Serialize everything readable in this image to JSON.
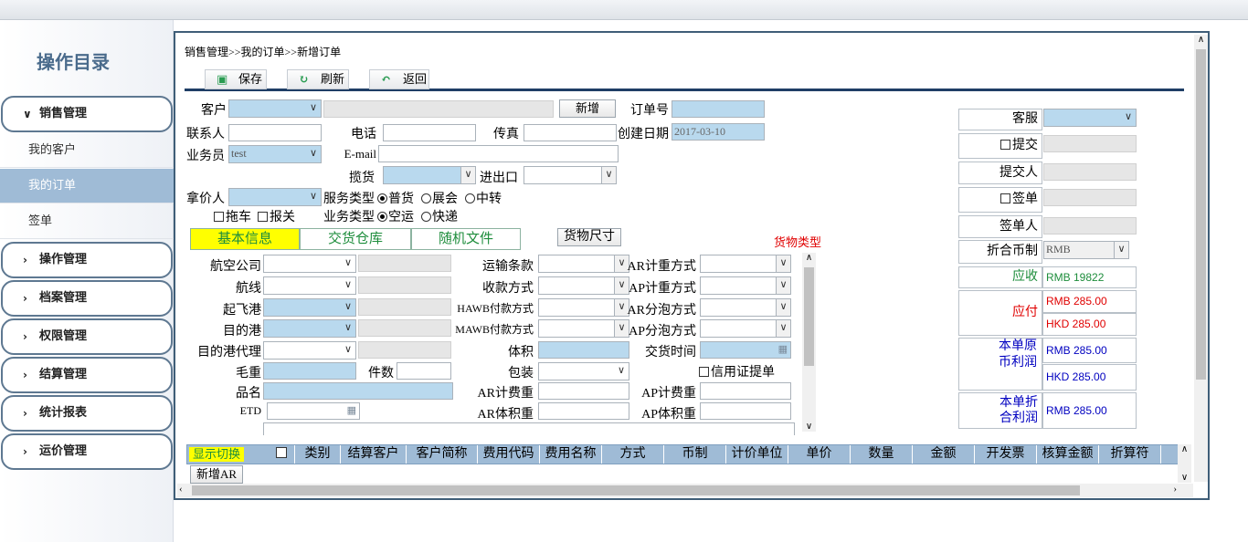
{
  "sidebar": {
    "title": "操作目录",
    "groups": [
      {
        "label": "销售管理",
        "open": true,
        "chev": "∨"
      },
      {
        "label": "操作管理",
        "chev": "›"
      },
      {
        "label": "档案管理",
        "chev": "›"
      },
      {
        "label": "权限管理",
        "chev": "›"
      },
      {
        "label": "结算管理",
        "chev": "›"
      },
      {
        "label": "统计报表",
        "chev": "›"
      },
      {
        "label": "运价管理",
        "chev": "›"
      }
    ],
    "items": [
      {
        "label": "我的客户"
      },
      {
        "label": "我的订单",
        "active": true
      },
      {
        "label": "签单"
      }
    ]
  },
  "breadcrumb": "销售管理>>我的订单>>新增订单",
  "toolbar": {
    "save": "保存",
    "refresh": "刷新",
    "back": "返回"
  },
  "form": {
    "customer": "客户",
    "new_btn": "新增",
    "order_no": "订单号",
    "contact": "联系人",
    "phone": "电话",
    "fax": "传真",
    "create_date": "创建日期",
    "create_date_val": "2017-03-10",
    "salesman": "业务员",
    "salesman_val": "test",
    "email": "E-mail",
    "pickup": "揽货",
    "import_export": "进出口",
    "price_taker": "拿价人",
    "service_type": "服务类型",
    "svc1": "普货",
    "svc2": "展会",
    "svc3": "中转",
    "truck": "拖车",
    "customs": "报关",
    "biz_type": "业务类型",
    "biz1": "空运",
    "biz2": "快递"
  },
  "tabs": {
    "basic": "基本信息",
    "warehouse": "交货仓库",
    "files": "随机文件",
    "cargo_size": "货物尺寸",
    "cargo_type": "货物类型"
  },
  "basic": {
    "airline": "航空公司",
    "route": "航线",
    "origin": "起飞港",
    "dest": "目的港",
    "dest_agent": "目的港代理",
    "gross": "毛重",
    "pieces": "件数",
    "goods": "品名",
    "etd": "ETD",
    "terms": "运输条款",
    "payment": "收款方式",
    "hawb": "HAWB付款方式",
    "mawb": "MAWB付款方式",
    "volume": "体积",
    "package": "包装",
    "ar_fee": "AR计费重",
    "ar_vol": "AR体积重",
    "ar_weight": "AR计重方式",
    "ap_weight": "AP计重方式",
    "ar_bubble": "AR分泡方式",
    "ap_bubble": "AP分泡方式",
    "delivery": "交货时间",
    "lc": "信用证提单",
    "ap_fee": "AP计费重",
    "ap_vol": "AP体积重"
  },
  "right": {
    "cs": "客服",
    "submit": "提交",
    "submitter": "提交人",
    "sign": "签单",
    "signer": "签单人",
    "currency": "折合币制",
    "currency_val": "RMB",
    "receivable": "应收",
    "receivable_val": "RMB 19822",
    "payable": "应付",
    "payable_rmb": "RMB 285.00",
    "payable_hkd": "HKD 285.00",
    "profit_orig": "本单原币利润",
    "profit_rmb": "RMB 285.00",
    "profit_hkd": "HKD 285.00",
    "profit_conv": "本单折合利润",
    "profit_conv_val": "RMB 285.00"
  },
  "grid": {
    "toggle": "显示切换",
    "add_ar": "新增AR",
    "columns": [
      "类别",
      "结算客户",
      "客户简称",
      "费用代码",
      "费用名称",
      "方式",
      "币制",
      "计价单位",
      "单价",
      "数量",
      "金额",
      "开发票",
      "核算金额",
      "折算符"
    ]
  },
  "colors": {
    "green": "#1e8d3c",
    "red": "#e00000",
    "blue": "#0000c0",
    "grid_header": "#9fbbd6"
  }
}
